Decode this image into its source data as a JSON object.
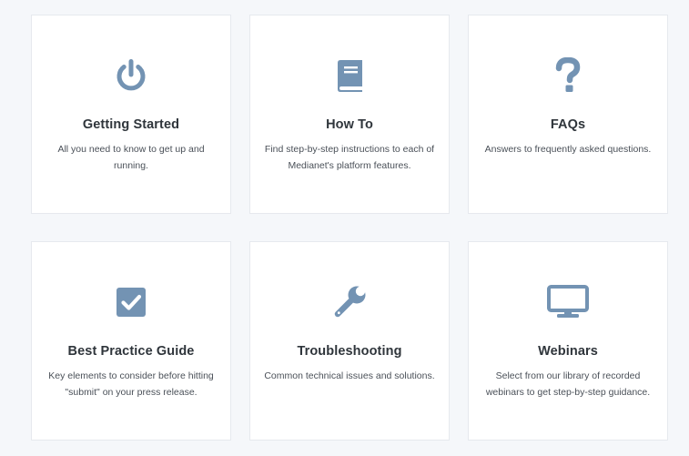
{
  "accent_color": "#7393b3",
  "cards": [
    {
      "icon": "power-icon",
      "title": "Getting Started",
      "description": "All you need to know to get up and running."
    },
    {
      "icon": "book-icon",
      "title": "How To",
      "description": "Find step-by-step instructions to each of Medianet's platform features."
    },
    {
      "icon": "question-mark-icon",
      "title": "FAQs",
      "description": "Answers to frequently asked questions."
    },
    {
      "icon": "checkbox-icon",
      "title": "Best Practice Guide",
      "description": "Key elements to consider before hitting \"submit\" on your press release."
    },
    {
      "icon": "wrench-icon",
      "title": "Troubleshooting",
      "description": "Common technical issues and solutions."
    },
    {
      "icon": "monitor-icon",
      "title": "Webinars",
      "description": "Select from our library of recorded webinars to get step-by-step guidance."
    }
  ]
}
